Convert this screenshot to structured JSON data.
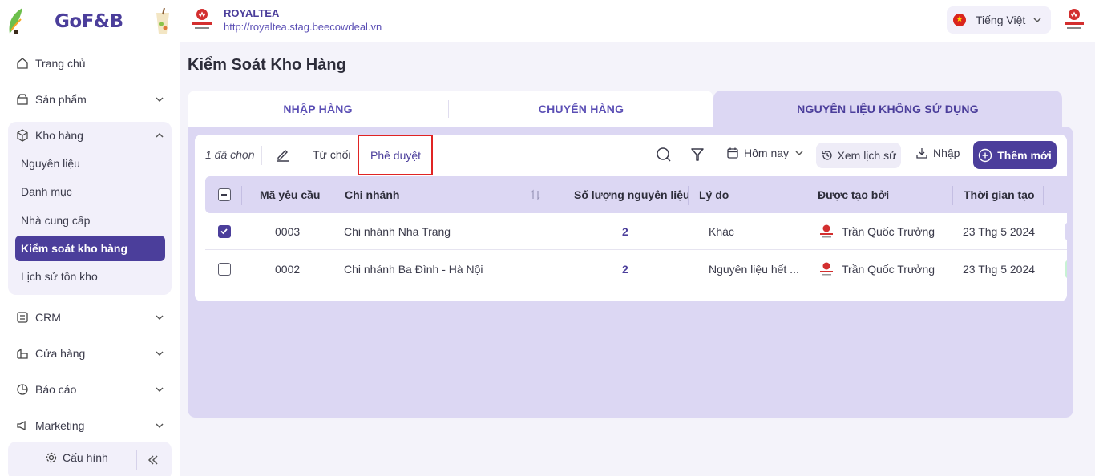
{
  "header": {
    "brand": "GoF&B",
    "store_name": "ROYALTEA",
    "store_url": "http://royaltea.stag.beecowdeal.vn",
    "language": "Tiếng Việt"
  },
  "sidebar": {
    "items": [
      {
        "label": "Trang chủ",
        "icon": "home-icon"
      },
      {
        "label": "Sản phẩm",
        "icon": "box-icon"
      },
      {
        "label": "Kho hàng",
        "icon": "cube-icon"
      },
      {
        "label": "CRM",
        "icon": "crm-icon"
      },
      {
        "label": "Cửa hàng",
        "icon": "store-icon"
      },
      {
        "label": "Báo cáo",
        "icon": "pie-chart-icon"
      },
      {
        "label": "Marketing",
        "icon": "marketing-icon"
      }
    ],
    "warehouse_sub": [
      {
        "label": "Nguyên liệu"
      },
      {
        "label": "Danh mục"
      },
      {
        "label": "Nhà cung cấp"
      },
      {
        "label": "Kiểm soát kho hàng",
        "active": true
      },
      {
        "label": "Lịch sử tồn kho"
      }
    ],
    "config_label": "Cấu hình"
  },
  "main": {
    "title": "Kiểm Soát Kho Hàng",
    "tabs": [
      {
        "label": "NHẬP HÀNG"
      },
      {
        "label": "CHUYỂN HÀNG"
      },
      {
        "label": "NGUYÊN LIỆU KHÔNG SỬ DỤNG",
        "active": true
      }
    ]
  },
  "toolbar": {
    "selected": "1 đã chọn",
    "reject": "Từ chối",
    "approve": "Phê duyệt",
    "date_filter": "Hôm nay",
    "history": "Xem lịch sử",
    "import": "Nhập",
    "add": "Thêm mới"
  },
  "table": {
    "columns": [
      "Mã yêu cầu",
      "Chi nhánh",
      "Số lượng nguyên liệu",
      "Lý do",
      "Được tạo bởi",
      "Thời gian tạo"
    ],
    "rows": [
      {
        "checked": true,
        "code": "0003",
        "branch": "Chi nhánh Nha Trang",
        "qty": "2",
        "reason": "Khác",
        "creator": "Trần Quốc Trưởng",
        "created": "23 Thg 5 2024"
      },
      {
        "checked": false,
        "code": "0002",
        "branch": "Chi nhánh Ba Đình - Hà Nội",
        "qty": "2",
        "reason": "Nguyên liệu hết ...",
        "creator": "Trần Quốc Trưởng",
        "created": "23 Thg 5 2024"
      }
    ]
  },
  "colors": {
    "primary": "#4b3e9b",
    "panel": "#dcd7f3",
    "highlight_box": "#e02424"
  }
}
